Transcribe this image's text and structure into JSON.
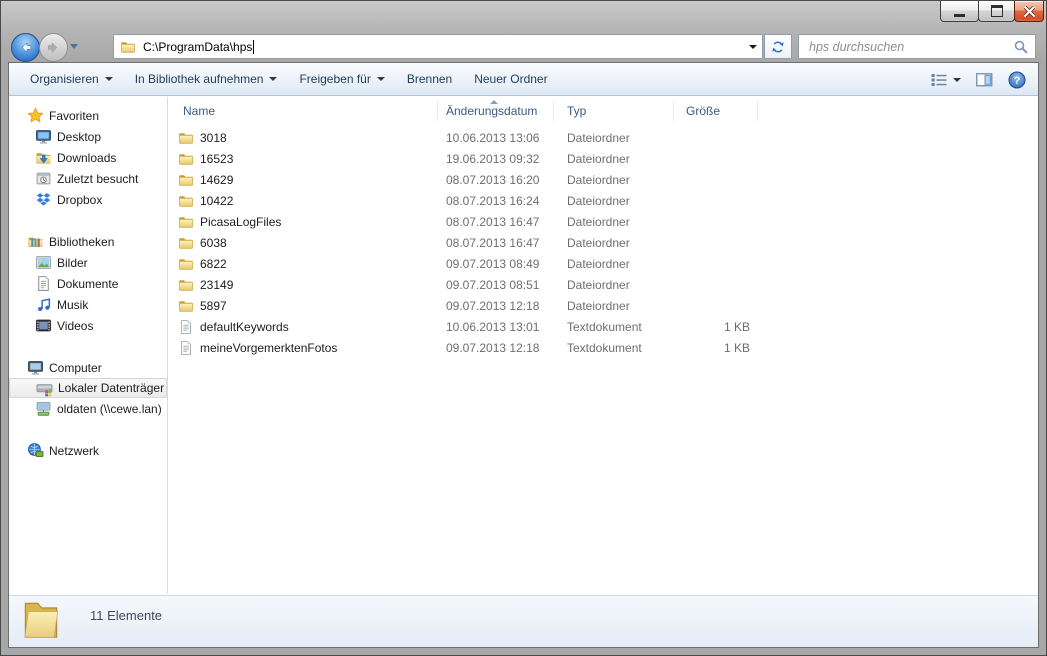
{
  "window": {
    "controls": [
      {
        "icon": "minimize-icon"
      },
      {
        "icon": "maximize-icon"
      },
      {
        "icon": "close-icon"
      }
    ]
  },
  "navbar": {
    "address_path": "C:\\ProgramData\\hps",
    "search_placeholder": "hps durchsuchen",
    "icons": [
      "back-arrow-icon",
      "forward-arrow-icon",
      "folder-icon",
      "refresh-icon",
      "search-icon"
    ]
  },
  "toolbar": {
    "items": [
      {
        "label": "Organisieren",
        "dropdown": true
      },
      {
        "label": "In Bibliothek aufnehmen",
        "dropdown": true
      },
      {
        "label": "Freigeben für",
        "dropdown": true
      },
      {
        "label": "Brennen",
        "dropdown": false
      },
      {
        "label": "Neuer Ordner",
        "dropdown": false
      }
    ],
    "right_icons": [
      "views-icon",
      "preview-pane-icon",
      "help-icon"
    ]
  },
  "sidebar": {
    "sections": [
      {
        "label": "Favoriten",
        "icon": "star-icon",
        "items": [
          {
            "label": "Desktop",
            "icon": "desktop-icon"
          },
          {
            "label": "Downloads",
            "icon": "downloads-icon"
          },
          {
            "label": "Zuletzt besucht",
            "icon": "recent-places-icon"
          },
          {
            "label": "Dropbox",
            "icon": "dropbox-icon"
          }
        ]
      },
      {
        "label": "Bibliotheken",
        "icon": "libraries-icon",
        "items": [
          {
            "label": "Bilder",
            "icon": "pictures-icon"
          },
          {
            "label": "Dokumente",
            "icon": "documents-icon"
          },
          {
            "label": "Musik",
            "icon": "music-icon"
          },
          {
            "label": "Videos",
            "icon": "videos-icon"
          }
        ]
      },
      {
        "label": "Computer",
        "icon": "computer-icon",
        "items": [
          {
            "label": "Lokaler Datenträger",
            "icon": "local-disk-icon",
            "selected": true
          },
          {
            "label": "oldaten (\\\\cewe.lan)",
            "icon": "network-drive-icon"
          }
        ]
      },
      {
        "label": "Netzwerk",
        "icon": "network-icon",
        "items": []
      }
    ]
  },
  "filelist": {
    "columns": [
      {
        "label": "Name"
      },
      {
        "label": "Änderungsdatum",
        "sort": "asc"
      },
      {
        "label": "Typ"
      },
      {
        "label": "Größe"
      }
    ],
    "rows": [
      {
        "name": "3018",
        "date": "10.06.2013 13:06",
        "type": "Dateiordner",
        "size": "",
        "icon": "folder-icon"
      },
      {
        "name": "16523",
        "date": "19.06.2013 09:32",
        "type": "Dateiordner",
        "size": "",
        "icon": "folder-icon"
      },
      {
        "name": "14629",
        "date": "08.07.2013 16:20",
        "type": "Dateiordner",
        "size": "",
        "icon": "folder-icon"
      },
      {
        "name": "10422",
        "date": "08.07.2013 16:24",
        "type": "Dateiordner",
        "size": "",
        "icon": "folder-icon"
      },
      {
        "name": "PicasaLogFiles",
        "date": "08.07.2013 16:47",
        "type": "Dateiordner",
        "size": "",
        "icon": "folder-icon"
      },
      {
        "name": "6038",
        "date": "08.07.2013 16:47",
        "type": "Dateiordner",
        "size": "",
        "icon": "folder-icon"
      },
      {
        "name": "6822",
        "date": "09.07.2013 08:49",
        "type": "Dateiordner",
        "size": "",
        "icon": "folder-icon"
      },
      {
        "name": "23149",
        "date": "09.07.2013 08:51",
        "type": "Dateiordner",
        "size": "",
        "icon": "folder-icon"
      },
      {
        "name": "5897",
        "date": "09.07.2013 12:18",
        "type": "Dateiordner",
        "size": "",
        "icon": "folder-icon"
      },
      {
        "name": "defaultKeywords",
        "date": "10.06.2013 13:01",
        "type": "Textdokument",
        "size": "1 KB",
        "icon": "textfile-icon"
      },
      {
        "name": "meineVorgemerktenFotos",
        "date": "09.07.2013 12:18",
        "type": "Textdokument",
        "size": "1 KB",
        "icon": "textfile-icon"
      }
    ]
  },
  "statusbar": {
    "text": "11 Elemente",
    "icon": "big-folder-icon"
  },
  "colors": {
    "close_button_red": "#d14e28",
    "back_button_blue": "#1d61b4",
    "toolbar_text": "#1e3c5c",
    "column_header_text": "#3b5a82",
    "secondary_text": "#6e6e6e",
    "frame_gray": "#a7a7a7",
    "toolbar_bottom_border": "#b0c4dc"
  }
}
